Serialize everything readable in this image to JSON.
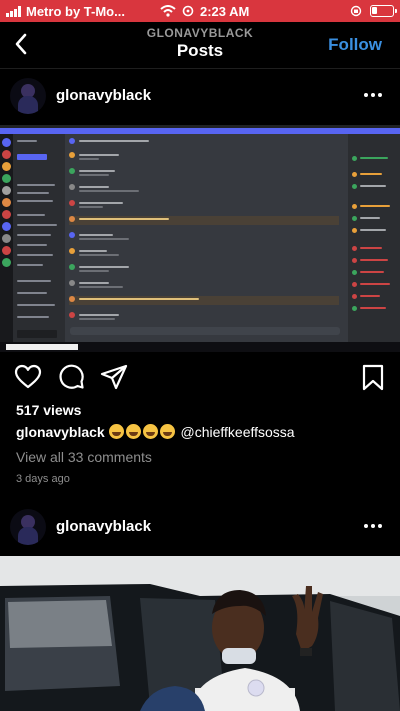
{
  "status_bar": {
    "carrier": "Metro by T-Mo...",
    "time": "2:23 AM",
    "background_color": "#d9363e"
  },
  "header": {
    "subtitle": "GLONAVYBLACK",
    "title": "Posts",
    "follow_label": "Follow",
    "follow_color": "#3a8fe0",
    "back_icon": "chevron-left-icon"
  },
  "posts": [
    {
      "username": "glonavyblack",
      "image_description_icon": "discord-screenshot",
      "views": "517 views",
      "caption": {
        "username": "glonavyblack",
        "emoji_count": 4,
        "mention": "@chieffkeeffsossa"
      },
      "comments_link": "View all 33 comments",
      "posted": "3 days ago"
    },
    {
      "username": "glonavyblack",
      "image_description_icon": "photo"
    }
  ],
  "action_icons": [
    "heart-icon",
    "comment-icon",
    "share-icon",
    "bookmark-icon"
  ]
}
